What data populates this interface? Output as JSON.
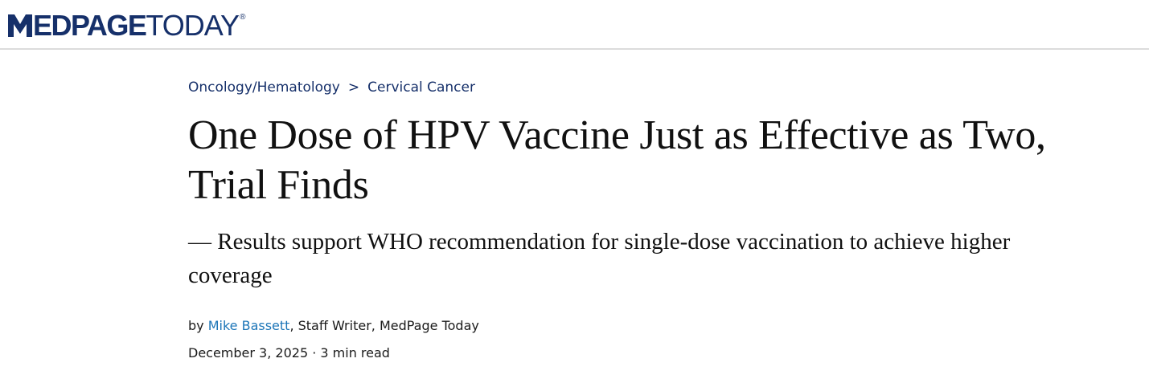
{
  "brand": {
    "name_bold": "EDPAGE",
    "name_light": "TODAY",
    "registered": "®",
    "color": "#16306a"
  },
  "breadcrumb": {
    "section": "Oncology/Hematology",
    "separator": ">",
    "topic": "Cervical Cancer"
  },
  "article": {
    "headline": "One Dose of HPV Vaccine Just as Effective as Two, Trial Finds",
    "dek": "— Results support WHO recommendation for single-dose vaccination to achieve higher coverage",
    "byline": {
      "prefix": "by ",
      "author": "Mike Bassett",
      "role": ", Staff Writer, MedPage Today"
    },
    "date": "December 3, 2025",
    "date_separator": " · ",
    "read_time": "3 min read"
  },
  "colors": {
    "link": "#1d76b8",
    "text": "#111111",
    "divider": "#dcdcdc"
  }
}
